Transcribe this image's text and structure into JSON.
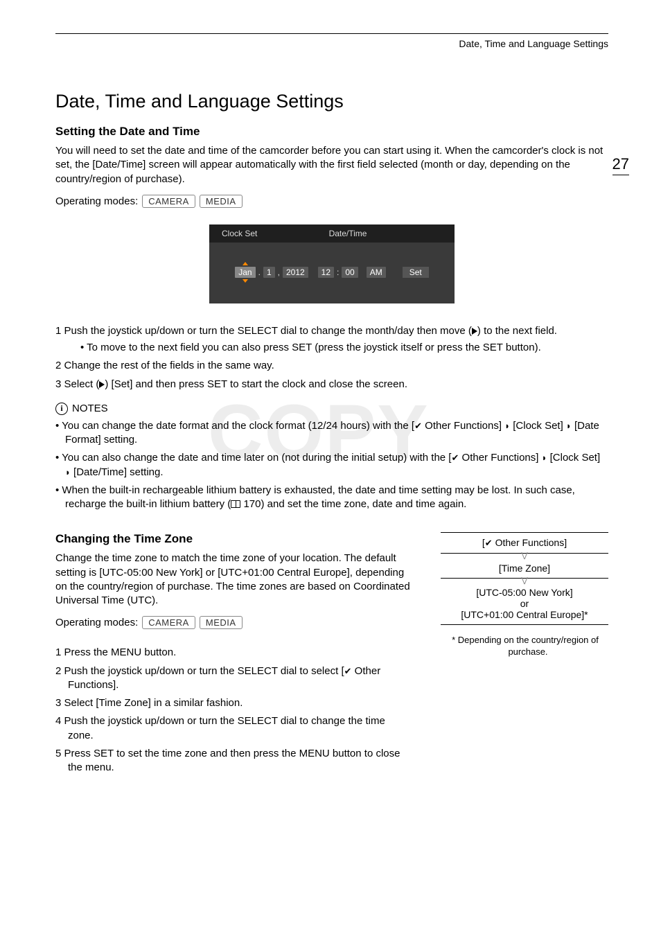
{
  "runningHead": "Date, Time and Language Settings",
  "pageNumber": "27",
  "title": "Date, Time and Language Settings",
  "sec1": {
    "heading": "Setting the Date and Time",
    "intro": "You will need to set the date and time of the camcorder before you can start using it. When the camcorder's clock is not set, the [Date/Time] screen will appear automatically with the first field selected (month or day, depending on the country/region of purchase).",
    "modesLabel": "Operating modes:",
    "modes": [
      "CAMERA",
      "MEDIA"
    ],
    "screenshot": {
      "tab1": "Clock Set",
      "tab2": "Date/Time",
      "month": "Jan",
      "dot1": ".",
      "day": "1",
      "dot2": ",",
      "year": "2012",
      "hour": "12",
      "colon": ":",
      "min": "00",
      "ampm": "AM",
      "set": "Set"
    },
    "steps": {
      "s1a": "1  Push the joystick up/down or turn the SELECT dial to change the month/day then move (",
      "s1b": ") to the next field.",
      "s1sub": "• To move to the next field you can also press SET (press the joystick itself or press the SET button).",
      "s2": "2  Change the rest of the fields in the same way.",
      "s3a": "3  Select (",
      "s3b": ") [Set] and then press SET to start the clock and close the screen."
    },
    "notesLabel": "NOTES",
    "notes": {
      "n1a": "You can change the date format and the clock format (12/24 hours) with the [",
      "n1b": " Other Functions] ",
      "n1c": " [Clock Set] ",
      "n1d": " [Date Format] setting.",
      "n2a": "You can also change the date and time later on (not during the initial setup) with the [",
      "n2b": " Other Functions] ",
      "n2c": " [Clock Set] ",
      "n2d": " [Date/Time] setting.",
      "n3a": "When the built-in rechargeable lithium battery is exhausted, the date and time setting may be lost. In such case, recharge the built-in lithium battery (",
      "n3b": " 170) and set the time zone, date and time again."
    }
  },
  "sec2": {
    "heading": "Changing the Time Zone",
    "intro": "Change the time zone to match the time zone of your location. The default setting is [UTC-05:00 New York] or [UTC+01:00 Central Europe], depending on the country/region of purchase. The time zones are based on Coordinated Universal Time (UTC).",
    "modesLabel": "Operating modes:",
    "modes": [
      "CAMERA",
      "MEDIA"
    ],
    "menuPath": {
      "r1a": "[",
      "r1b": " Other Functions]",
      "r2": "[Time Zone]",
      "r3": "[UTC-05:00 New York]",
      "r3or": "or",
      "r3b": "[UTC+01:00 Central Europe]*"
    },
    "footnote": "* Depending on the country/region of purchase.",
    "steps": {
      "s1": "1  Press the MENU button.",
      "s2a": "2  Push the joystick up/down or turn the SELECT dial to select [",
      "s2b": " Other Functions].",
      "s3": "3  Select [Time Zone] in a similar fashion.",
      "s4": "4  Push the joystick up/down or turn the SELECT dial to change the time zone.",
      "s5": "5  Press SET to set the time zone and then press the MENU button to close the menu."
    }
  },
  "watermark": "COPY"
}
